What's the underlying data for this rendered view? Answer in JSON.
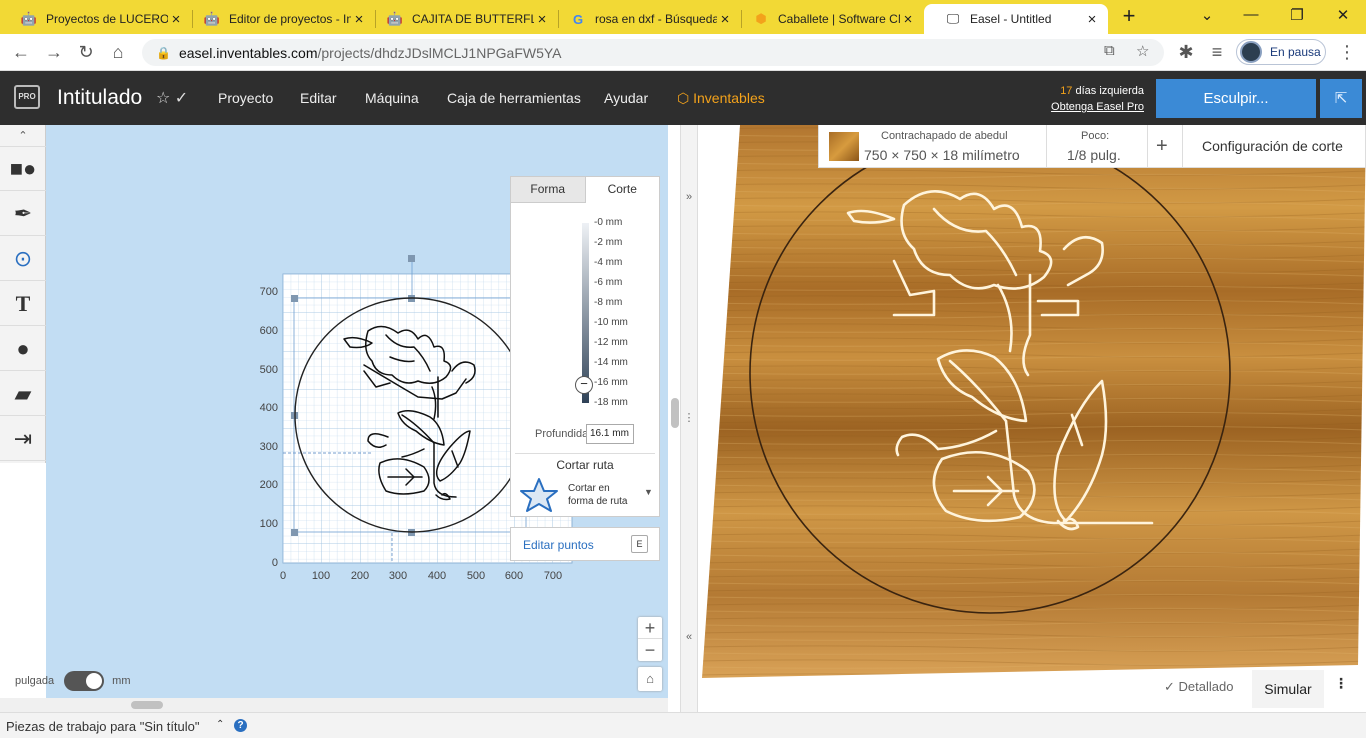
{
  "browser": {
    "tabs": [
      {
        "title": "Proyectos de LUCERO",
        "icon": "robot-favicon"
      },
      {
        "title": "Editor de proyectos - In",
        "icon": "robot-favicon"
      },
      {
        "title": "CAJITA DE BUTTERFLY",
        "icon": "robot-favicon"
      },
      {
        "title": "rosa en dxf - Búsqueda",
        "icon": "google-favicon"
      },
      {
        "title": "Caballete | Software CN",
        "icon": "hexagon-favicon"
      },
      {
        "title": "Easel - Untitled",
        "icon": "monitor-favicon"
      }
    ],
    "url_host": "easel.inventables.com",
    "url_path": "/projects/dhdzJDslMCLJ1NPGaFW5YA",
    "profile_label": "En pausa"
  },
  "easel": {
    "title": "Intitulado",
    "menu": [
      "Proyecto",
      "Editar",
      "Máquina",
      "Caja de herramientas",
      "Ayudar"
    ],
    "brand": "Inventables",
    "trial_days": "17",
    "trial_text": "días izquierda",
    "trial_link": "Obtenga Easel Pro",
    "carve_button": "Esculpir..."
  },
  "canvas": {
    "y_ticks": [
      "700",
      "600",
      "500",
      "400",
      "300",
      "200",
      "100",
      "0"
    ],
    "x_ticks": [
      "0",
      "100",
      "200",
      "300",
      "400",
      "500",
      "600",
      "700"
    ],
    "unit_left": "pulgada",
    "unit_right": "mm"
  },
  "cut_panel": {
    "tab_shape": "Forma",
    "tab_cut": "Corte",
    "depth_ticks": [
      "-0 mm",
      "-2 mm",
      "-4 mm",
      "-6 mm",
      "-8 mm",
      "-10 mm",
      "-12 mm",
      "-14 mm",
      "-16 mm",
      "-18 mm"
    ],
    "depth_label": "Profundidad",
    "depth_value": "16.1 mm",
    "cut_path_title": "Cortar ruta",
    "cut_path_option_1": "Cortar en",
    "cut_path_option_2": "forma de ruta",
    "edit_points": "Editar puntos",
    "edit_points_key": "E"
  },
  "preview": {
    "material_name": "Contrachapado de abedul",
    "material_size": "750 × 750 × 18 milímetro",
    "bit_label": "Poco:",
    "bit_value": "1/8 pulg.",
    "cut_settings": "Configuración de corte",
    "detailed": "Detallado",
    "simulate": "Simular"
  },
  "status": {
    "workpieces": "Piezas de trabajo para \"Sin título\""
  }
}
